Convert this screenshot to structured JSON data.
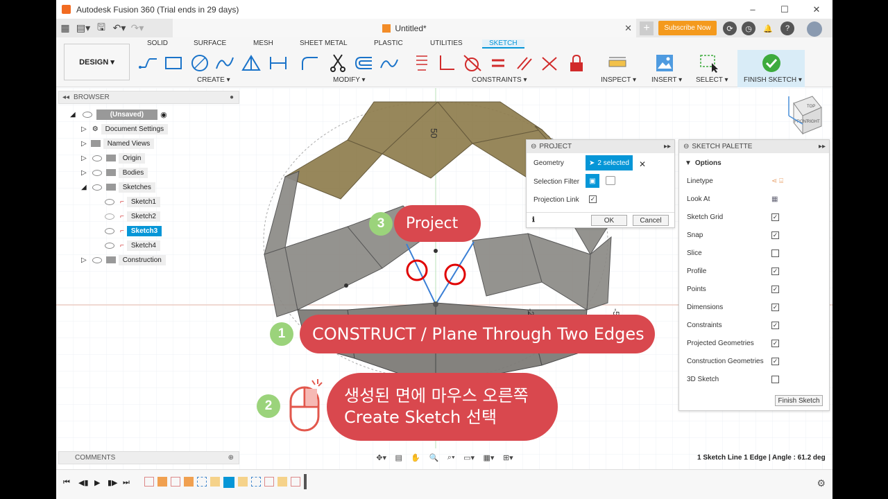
{
  "window": {
    "title": "Autodesk Fusion 360 (Trial ends in 29 days)",
    "minimize": "–",
    "maximize": "☐",
    "close": "✕"
  },
  "tabbar": {
    "doc_title": "Untitled*",
    "subscribe": "Subscribe Now"
  },
  "ribbon": {
    "design_label": "DESIGN ▾",
    "tabs": [
      "SOLID",
      "SURFACE",
      "MESH",
      "SHEET METAL",
      "PLASTIC",
      "UTILITIES",
      "SKETCH"
    ],
    "active_tab": "SKETCH",
    "groups": {
      "create": "CREATE ▾",
      "modify": "MODIFY ▾",
      "constraints": "CONSTRAINTS ▾",
      "inspect": "INSPECT ▾",
      "insert": "INSERT ▾",
      "select": "SELECT ▾",
      "finish": "FINISH SKETCH ▾"
    }
  },
  "browser": {
    "header": "BROWSER",
    "root": "(Unsaved)",
    "items": [
      "Document Settings",
      "Named Views",
      "Origin",
      "Bodies",
      "Sketches",
      "Sketch1",
      "Sketch2",
      "Sketch3",
      "Sketch4",
      "Construction"
    ],
    "selected": "Sketch3"
  },
  "comments": "COMMENTS",
  "project_dialog": {
    "title": "PROJECT",
    "geometry_label": "Geometry",
    "geometry_value": "2 selected",
    "selection_filter_label": "Selection Filter",
    "projection_link_label": "Projection Link",
    "ok": "OK",
    "cancel": "Cancel"
  },
  "sketch_palette": {
    "title": "SKETCH PALETTE",
    "section": "Options",
    "rows": [
      {
        "label": "Linetype",
        "checked": null
      },
      {
        "label": "Look At",
        "checked": null
      },
      {
        "label": "Sketch Grid",
        "checked": true
      },
      {
        "label": "Snap",
        "checked": true
      },
      {
        "label": "Slice",
        "checked": false
      },
      {
        "label": "Profile",
        "checked": true
      },
      {
        "label": "Points",
        "checked": true
      },
      {
        "label": "Dimensions",
        "checked": true
      },
      {
        "label": "Constraints",
        "checked": true
      },
      {
        "label": "Projected Geometries",
        "checked": true
      },
      {
        "label": "Construction Geometries",
        "checked": true
      },
      {
        "label": "3D Sketch",
        "checked": false
      }
    ],
    "finish_button": "Finish Sketch"
  },
  "viewport": {
    "dim_labels": [
      "50",
      "25",
      "-25",
      "-50"
    ],
    "viewcube": {
      "top": "TOP",
      "front": "FRONT",
      "right": "RIGHT"
    }
  },
  "callouts": {
    "step1_num": "1",
    "step1_text": "CONSTRUCT / Plane Through Two Edges",
    "step2_num": "2",
    "step2_line1": "생성된 면에 마우스 오른쪽",
    "step2_line2": "Create Sketch 선택",
    "step3_num": "3",
    "step3_text": "Project"
  },
  "status_text": "1 Sketch Line 1 Edge | Angle : 61.2 deg",
  "colors": {
    "accent": "#0696d7",
    "callout": "#d9484e",
    "step_badge": "#9bd37b",
    "subscribe": "#f49a1d",
    "finish_check": "#3dab3d"
  }
}
